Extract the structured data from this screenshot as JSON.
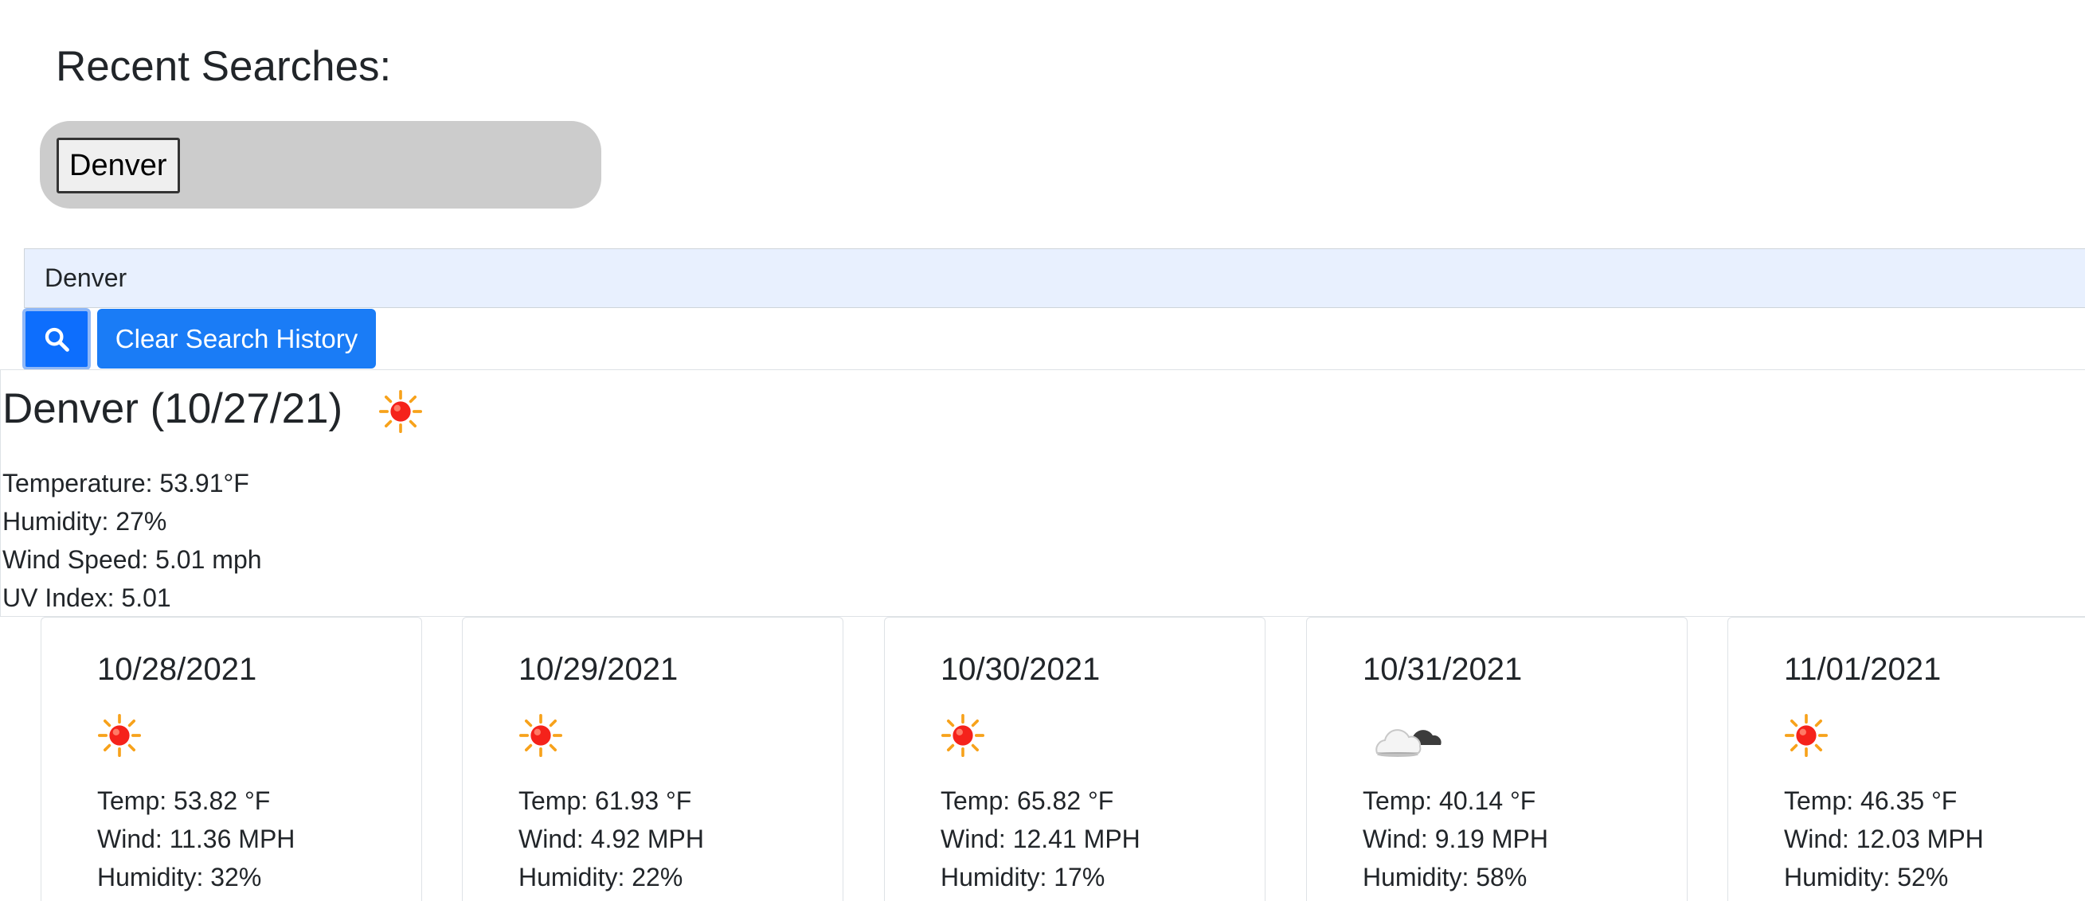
{
  "recent": {
    "title": "Recent Searches:",
    "items": [
      "Denver"
    ]
  },
  "search": {
    "value": "Denver",
    "button_icon": "search-icon",
    "clear_label": "Clear Search History"
  },
  "current": {
    "title": "Denver (10/27/21)",
    "icon": "sun-icon",
    "temperature": "Temperature: 53.91°F",
    "humidity": "Humidity: 27%",
    "wind": "Wind Speed: 5.01 mph",
    "uv": "UV Index: 5.01"
  },
  "forecast": [
    {
      "date": "10/28/2021",
      "icon": "sun-icon",
      "temp": "Temp: 53.82 °F",
      "wind": "Wind: 11.36 MPH",
      "humidity": "Humidity: 32%"
    },
    {
      "date": "10/29/2021",
      "icon": "sun-icon",
      "temp": "Temp: 61.93 °F",
      "wind": "Wind: 4.92 MPH",
      "humidity": "Humidity: 22%"
    },
    {
      "date": "10/30/2021",
      "icon": "sun-icon",
      "temp": "Temp: 65.82 °F",
      "wind": "Wind: 12.41 MPH",
      "humidity": "Humidity: 17%"
    },
    {
      "date": "10/31/2021",
      "icon": "cloud-icon",
      "temp": "Temp: 40.14 °F",
      "wind": "Wind: 9.19 MPH",
      "humidity": "Humidity: 58%"
    },
    {
      "date": "11/01/2021",
      "icon": "sun-icon",
      "temp": "Temp: 46.35 °F",
      "wind": "Wind: 12.03 MPH",
      "humidity": "Humidity: 52%"
    }
  ],
  "colors": {
    "primary": "#0d6efd",
    "input_bg": "#e8f0fe",
    "recent_bg": "#cccccc",
    "sun": "#f5221b",
    "sun_rays": "#f7a21b"
  }
}
